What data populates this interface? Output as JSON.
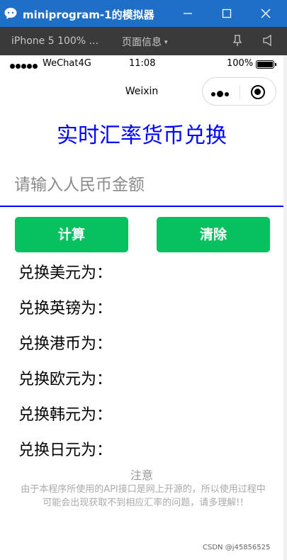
{
  "window": {
    "title": "miniprogram-1的模拟器",
    "buttons": [
      "minimize-icon",
      "maximize-icon",
      "close-icon"
    ],
    "color": "#1f6fc7"
  },
  "toolbar": {
    "device": "iPhone 5 100% ...",
    "page_info": "页面信息",
    "caret": "▾"
  },
  "status_bar": {
    "carrier": "WeChat4G",
    "time": "11:08",
    "battery": "100%"
  },
  "nav": {
    "title": "Weixin"
  },
  "page": {
    "heading": "实时汇率货币兑换",
    "input_placeholder": "请输入人民币金额",
    "calc_button": "计算",
    "clear_button": "清除",
    "results": [
      {
        "label": "兑换美元为："
      },
      {
        "label": "兑换英镑为："
      },
      {
        "label": "兑换港币为："
      },
      {
        "label": "兑换欧元为："
      },
      {
        "label": "兑换韩元为："
      },
      {
        "label": "兑换日元为："
      }
    ],
    "note_title": "注意",
    "note_body": "由于本程序所使用的API接口是网上开源的，所以使用过程中可能会出现获取不到相应汇率的问题，请多理解!!"
  },
  "watermark": "CSDN @j45856525",
  "colors": {
    "accent": "#07c160",
    "heading": "#0000ff",
    "underline": "#0000ff"
  }
}
